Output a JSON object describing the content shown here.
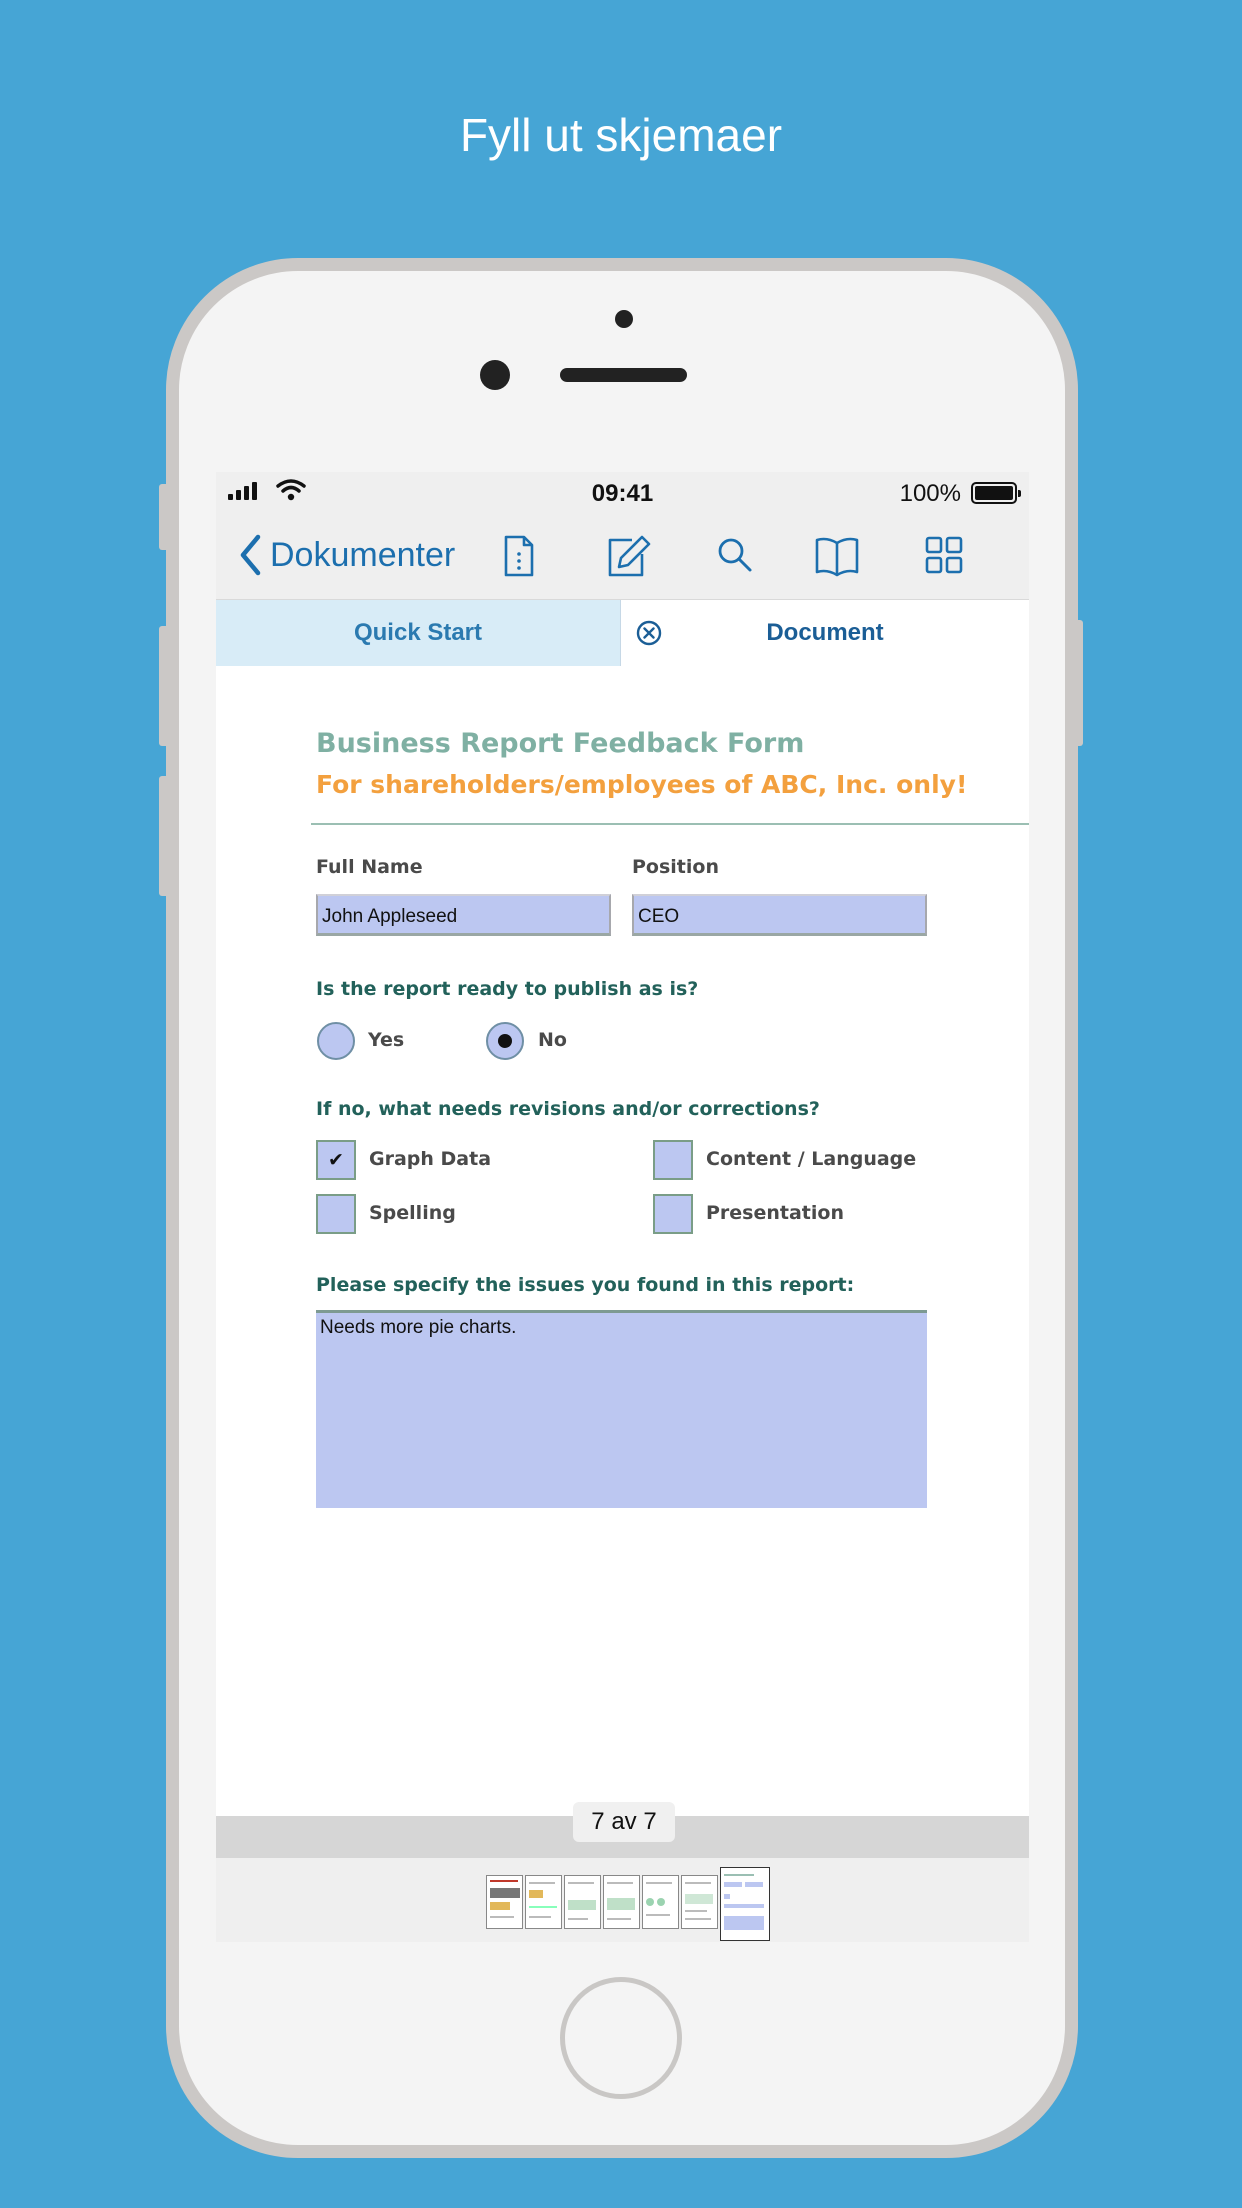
{
  "headline": "Fyll ut skjemaer",
  "status_bar": {
    "time": "09:41",
    "battery": "100%"
  },
  "navbar": {
    "back_label": "Dokumenter",
    "icons": [
      "document-info-icon",
      "annotate-icon",
      "search-icon",
      "bookmarks-icon",
      "thumbnails-grid-icon"
    ]
  },
  "tabs": {
    "quick_start": "Quick Start",
    "document": "Document"
  },
  "form": {
    "title": "Business Report Feedback Form",
    "subtitle": "For shareholders/employees of ABC, Inc. only!",
    "full_name_label": "Full Name",
    "full_name_value": "John Appleseed",
    "position_label": "Position",
    "position_value": "CEO",
    "publish_question": "Is the report ready to publish as is?",
    "publish_options": [
      {
        "label": "Yes",
        "selected": false
      },
      {
        "label": "No",
        "selected": true
      }
    ],
    "revisions_question": "If no, what needs revisions and/or corrections?",
    "revisions": [
      {
        "label": "Graph Data",
        "checked": true,
        "mark": "✔"
      },
      {
        "label": "Content / Language",
        "checked": false
      },
      {
        "label": "Spelling",
        "checked": false
      },
      {
        "label": "Presentation",
        "checked": false
      }
    ],
    "issues_label": "Please specify the issues you found in this report:",
    "issues_value": "Needs more pie charts."
  },
  "pager": {
    "page_indicator": "7 av 7",
    "total_pages": 7,
    "current_page": 7
  },
  "colors": {
    "background": "#46a5d5",
    "accent": "#1c6fae",
    "form_title": "#7fb0a3",
    "form_subtitle": "#f3a03e",
    "field_fill": "#bcc7f1"
  }
}
